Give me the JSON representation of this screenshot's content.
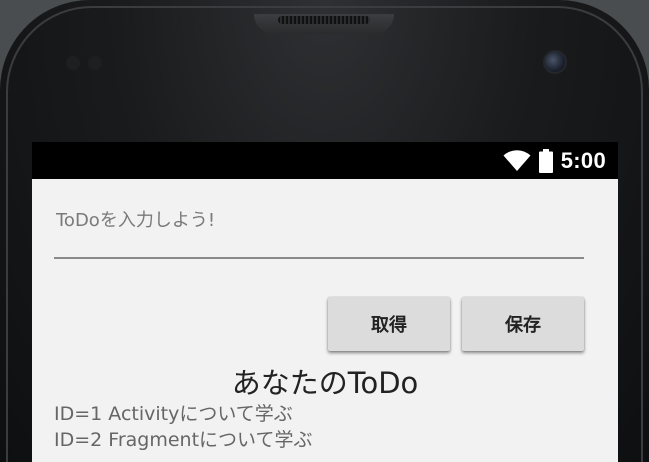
{
  "status_bar": {
    "time": "5:00",
    "icons": [
      "wifi-icon",
      "battery-icon"
    ]
  },
  "input": {
    "placeholder": "ToDoを入力しよう!",
    "value": ""
  },
  "buttons": {
    "get_label": "取得",
    "save_label": "保存"
  },
  "heading": "あなたのToDo",
  "todos": [
    {
      "text": "ID=1 Activityについて学ぶ"
    },
    {
      "text": "ID=2 Fragmentについて学ぶ"
    }
  ],
  "colors": {
    "status_bar": "#000000",
    "screen_bg": "#f2f2f2",
    "button_bg": "#dcdcdc",
    "device_body": "#1a1b1d"
  }
}
